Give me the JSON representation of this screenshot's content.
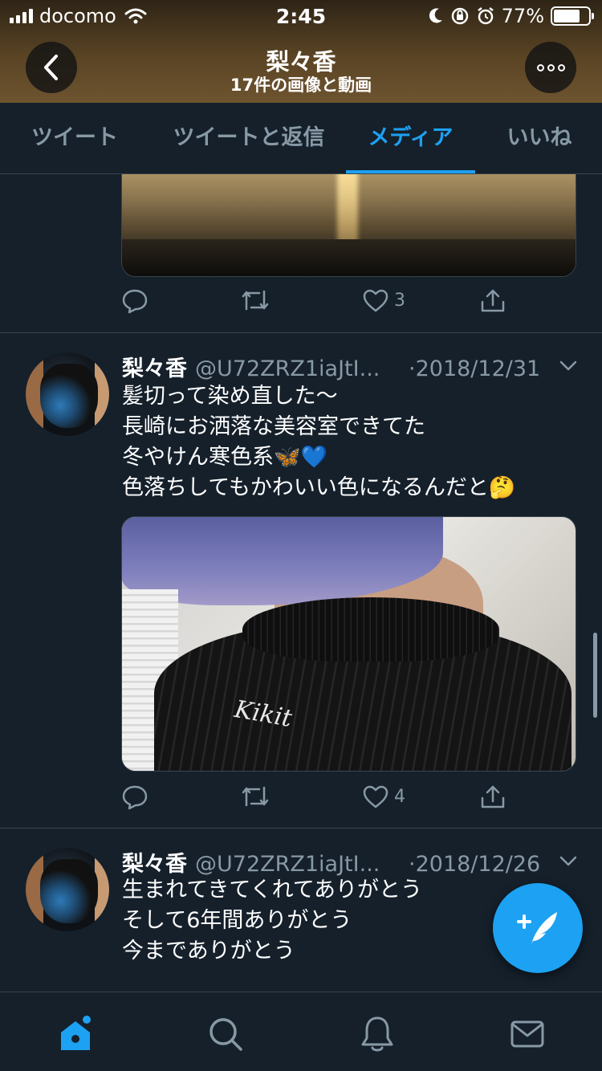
{
  "status_bar": {
    "carrier": "docomo",
    "time": "2:45",
    "battery": "77%",
    "battery_level": 0.77
  },
  "header": {
    "title": "梨々香",
    "subtitle": "17件の画像と動画"
  },
  "tabs": [
    {
      "label": "ツイート"
    },
    {
      "label": "ツイートと返信"
    },
    {
      "label": "メディア",
      "active": true
    },
    {
      "label": "いいね"
    }
  ],
  "tweets": [
    {
      "like_count": "3",
      "image": "sunset-sea-photo"
    },
    {
      "name": "梨々香",
      "handle": "@U72ZRZ1iaJtI...",
      "date": "·2018/12/31",
      "text": "髪切って染め直した〜\n長崎にお洒落な美容室できてた\n冬やけん寒色系🦋💙\n色落ちしてもかわいい色になるんだと🤔",
      "like_count": "4",
      "image_logo_text": "Kikit"
    },
    {
      "name": "梨々香",
      "handle": "@U72ZRZ1iaJtI...",
      "date": "·2018/12/26",
      "text": "生まれてきてくれてありがとう\nそして6年間ありがとう\n今までありがとう"
    }
  ],
  "colors": {
    "background": "#15202b",
    "accent": "#1da1f2",
    "muted": "#8899a6",
    "divider": "#38444d"
  },
  "icons": [
    "back-icon",
    "more-icon",
    "reply-icon",
    "retweet-icon",
    "like-icon",
    "share-icon",
    "chevron-down-icon",
    "compose-icon",
    "home-icon",
    "search-icon",
    "notifications-icon",
    "messages-icon"
  ]
}
